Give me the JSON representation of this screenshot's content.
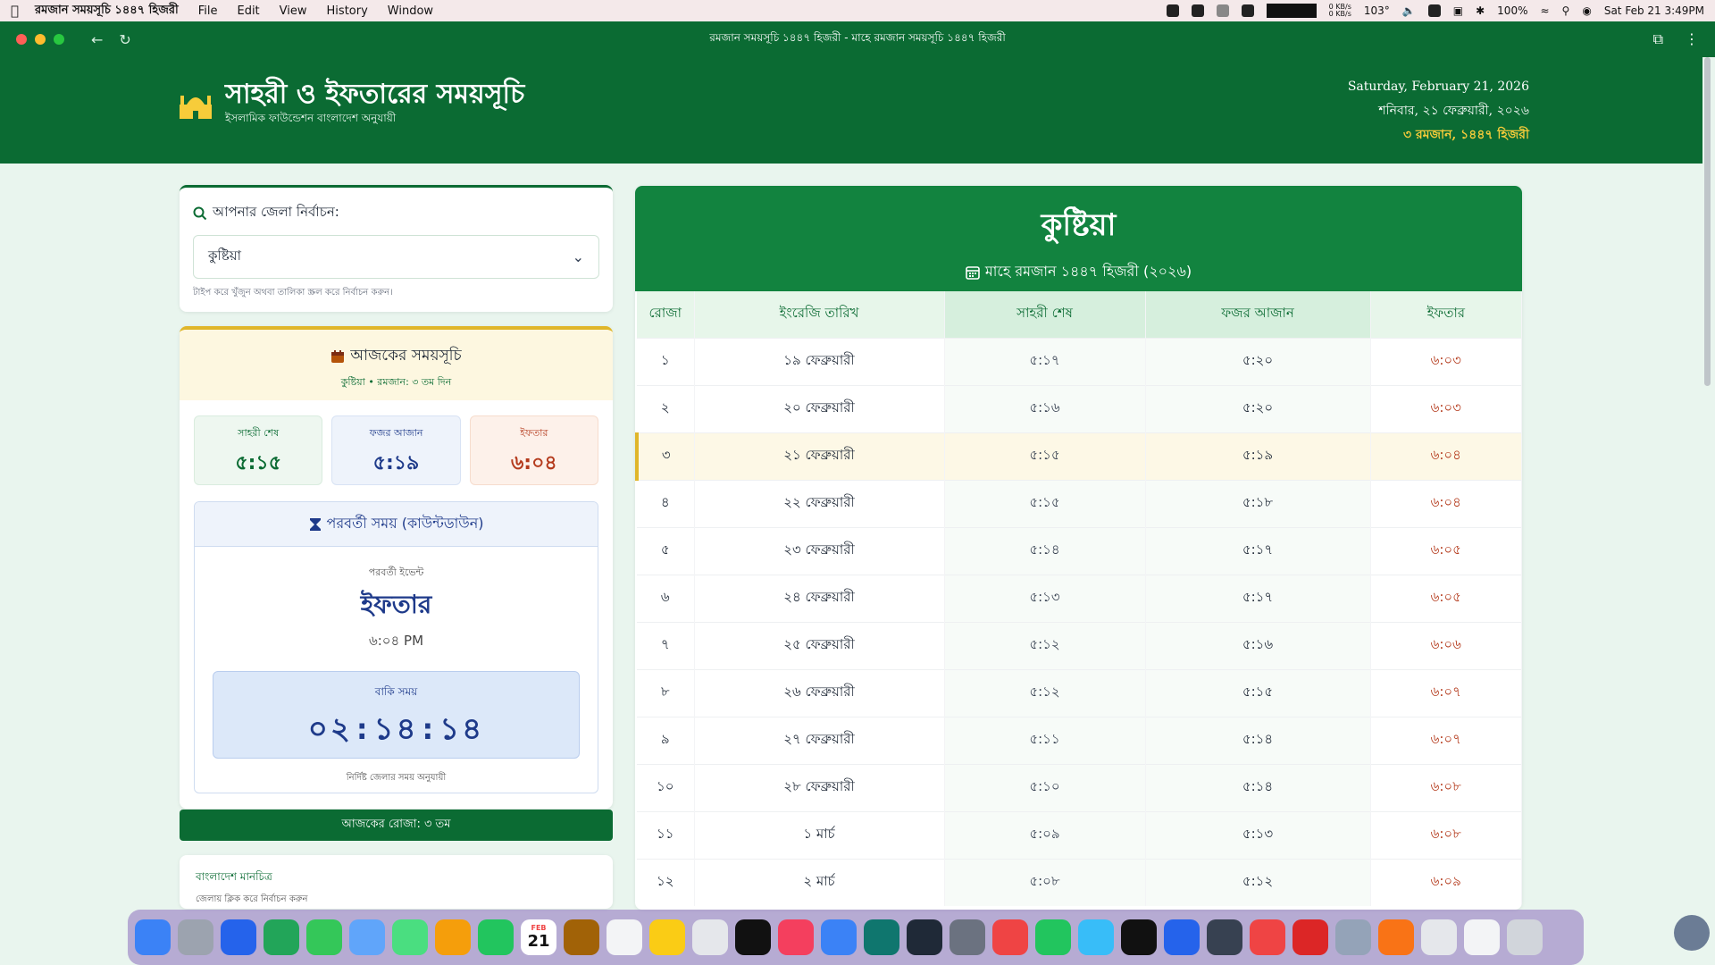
{
  "menubar": {
    "app_name": "রমজান সময়সূচি ১৪৪৭ হিজরী",
    "menus": [
      "File",
      "Edit",
      "View",
      "History",
      "Window"
    ],
    "net_up": "0 KB/s",
    "net_down": "0 KB/s",
    "temperature": "103°",
    "battery": "100%",
    "clock": "Sat Feb 21  3:49PM"
  },
  "browser": {
    "title": "রমজান সময়সূচি ১৪৪৭ হিজরী - মাহে রমজান সময়সূচি ১৪৪৭ হিজরী"
  },
  "header": {
    "title": "সাহরী ও ইফতারের সময়সূচি",
    "subtitle": "ইসলামিক ফাউন্ডেশন বাংলাদেশ অনুযায়ী",
    "date_en": "Saturday, February 21, 2026",
    "date_bn": "শনিবার, ২১ ফেব্রুয়ারী, ২০২৬",
    "date_hijri": "৩ রমজান, ১৪৪৭ হিজরী"
  },
  "district": {
    "label": "আপনার জেলা নির্বাচন:",
    "selected": "কুষ্টিয়া",
    "help": "টাইপ করে খুঁজুন অথবা তালিকা স্ক্রল করে নির্বাচন করুন।"
  },
  "today": {
    "title": "আজকের সময়সূচি",
    "subtitle": "কুষ্টিয়া • রমজান: ৩ তম দিন",
    "sehri_label": "সাহরী শেষ",
    "sehri_time": "৫:১৫",
    "fajr_label": "ফজর আজান",
    "fajr_time": "৫:১৯",
    "iftar_label": "ইফতার",
    "iftar_time": "৬:০৪"
  },
  "countdown": {
    "title": "পরবর্তী সময় (কাউন্টডাউন)",
    "next_label": "পরবর্তী ইভেন্ট",
    "next_event": "ইফতার",
    "next_time": "৬:০৪ PM",
    "remain_label": "বাকি সময়",
    "remain_value": "০২:১৪:১৪",
    "note": "নির্দিষ্ট জেলার সময় অনুযায়ী"
  },
  "today_roza": "আজকের রোজা: ৩ তম",
  "map": {
    "title": "বাংলাদেশ মানচিত্র",
    "subtitle": "জেলায় ক্লিক করে নির্বাচন করুন"
  },
  "schedule": {
    "district": "কুষ্টিয়া",
    "subtitle": "মাহে রমজান ১৪৪৭ হিজরী (২০২৬)",
    "columns": [
      "রোজা",
      "ইংরেজি তারিখ",
      "সাহরী শেষ",
      "ফজর আজান",
      "ইফতার"
    ],
    "today_index": 2,
    "rows": [
      [
        "১",
        "১৯ ফেব্রুয়ারী",
        "৫:১৭",
        "৫:২০",
        "৬:০৩"
      ],
      [
        "২",
        "২০ ফেব্রুয়ারী",
        "৫:১৬",
        "৫:২০",
        "৬:০৩"
      ],
      [
        "৩",
        "২১ ফেব্রুয়ারী",
        "৫:১৫",
        "৫:১৯",
        "৬:০৪"
      ],
      [
        "৪",
        "২২ ফেব্রুয়ারী",
        "৫:১৫",
        "৫:১৮",
        "৬:০৪"
      ],
      [
        "৫",
        "২৩ ফেব্রুয়ারী",
        "৫:১৪",
        "৫:১৭",
        "৬:০৫"
      ],
      [
        "৬",
        "২৪ ফেব্রুয়ারী",
        "৫:১৩",
        "৫:১৭",
        "৬:০৫"
      ],
      [
        "৭",
        "২৫ ফেব্রুয়ারী",
        "৫:১২",
        "৫:১৬",
        "৬:০৬"
      ],
      [
        "৮",
        "২৬ ফেব্রুয়ারী",
        "৫:১২",
        "৫:১৫",
        "৬:০৭"
      ],
      [
        "৯",
        "২৭ ফেব্রুয়ারী",
        "৫:১১",
        "৫:১৪",
        "৬:০৭"
      ],
      [
        "১০",
        "২৮ ফেব্রুয়ারী",
        "৫:১০",
        "৫:১৪",
        "৬:০৮"
      ],
      [
        "১১",
        "১ মার্চ",
        "৫:০৯",
        "৫:১৩",
        "৬:০৮"
      ],
      [
        "১২",
        "২ মার্চ",
        "৫:০৮",
        "৫:১২",
        "৬:০৯"
      ]
    ]
  },
  "dock": {
    "calendar_month": "FEB",
    "calendar_day": "21",
    "icons": [
      {
        "name": "finder-icon",
        "color": "#3b82f6"
      },
      {
        "name": "launchpad-icon",
        "color": "#9ca3af"
      },
      {
        "name": "safari-icon",
        "color": "#2563eb"
      },
      {
        "name": "chrome-icon",
        "color": "#22a559"
      },
      {
        "name": "messages-icon",
        "color": "#34c759"
      },
      {
        "name": "mail-icon",
        "color": "#60a5fa"
      },
      {
        "name": "maps-icon",
        "color": "#4ade80"
      },
      {
        "name": "photos-icon",
        "color": "#f59e0b"
      },
      {
        "name": "facetime-icon",
        "color": "#22c55e"
      },
      {
        "name": "calendar-icon",
        "color": "#ffffff"
      },
      {
        "name": "contacts-icon",
        "color": "#a16207"
      },
      {
        "name": "reminders-icon",
        "color": "#f3f4f6"
      },
      {
        "name": "notes-icon",
        "color": "#facc15"
      },
      {
        "name": "freeform-icon",
        "color": "#e5e7eb"
      },
      {
        "name": "apple-tv-icon",
        "color": "#111111"
      },
      {
        "name": "music-icon",
        "color": "#f43f5e"
      },
      {
        "name": "app-store-icon",
        "color": "#3b82f6"
      },
      {
        "name": "quran-icon",
        "color": "#0f766e"
      },
      {
        "name": "terminal-icon",
        "color": "#1f2937"
      },
      {
        "name": "system-settings-icon",
        "color": "#6b7280"
      },
      {
        "name": "youtube-icon",
        "color": "#ef4444"
      },
      {
        "name": "whatsapp-icon",
        "color": "#22c55e"
      },
      {
        "name": "telegram-icon",
        "color": "#38bdf8"
      },
      {
        "name": "podcasts-icon",
        "color": "#111111"
      },
      {
        "name": "vscode-icon",
        "color": "#2563eb"
      },
      {
        "name": "text-editor-icon",
        "color": "#374151"
      },
      {
        "name": "pdf-reader-icon",
        "color": "#ef4444"
      },
      {
        "name": "wps-office-icon",
        "color": "#dc2626"
      },
      {
        "name": "preview-icon",
        "color": "#94a3b8"
      },
      {
        "name": "microsoft-office-icon",
        "color": "#f97316"
      },
      {
        "name": "archive-utility-icon",
        "color": "#e5e7eb"
      },
      {
        "name": "documents-folder-icon",
        "color": "#f3f4f6"
      },
      {
        "name": "trash-icon",
        "color": "#d1d5db"
      }
    ]
  }
}
